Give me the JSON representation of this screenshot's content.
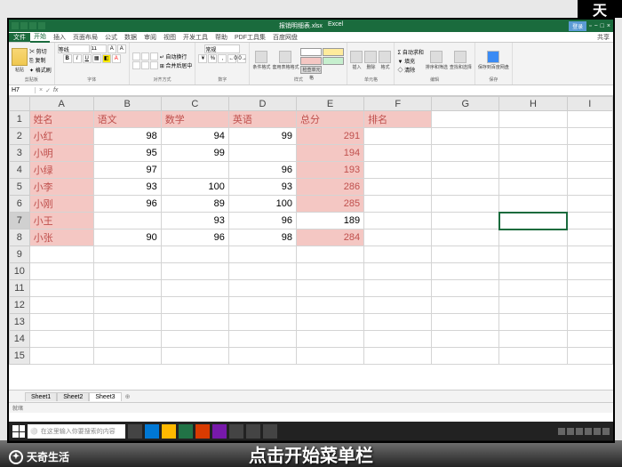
{
  "app": {
    "doc_title": "报销明细表.xlsx",
    "app_name": "Excel",
    "signin": "登录"
  },
  "tabs": {
    "file": "文件",
    "items": [
      "开始",
      "插入",
      "页面布局",
      "公式",
      "数据",
      "审阅",
      "视图",
      "开发工具",
      "帮助",
      "PDF工具集",
      "百度网盘"
    ],
    "active": 0,
    "share": "共享"
  },
  "ribbon": {
    "clipboard": {
      "paste": "粘贴",
      "cut": "剪切",
      "copy": "复制",
      "label": "剪贴板"
    },
    "font": {
      "name": "等线",
      "size": "11",
      "label": "字体"
    },
    "align": {
      "wrap": "自动换行",
      "merge": "合并后居中",
      "label": "对齐方式"
    },
    "number": {
      "format": "常规",
      "label": "数字"
    },
    "styles": {
      "cond": "条件格式",
      "table": "套用表格格式",
      "cell": "检查单元格",
      "label": "样式"
    },
    "cells": {
      "insert": "插入",
      "delete": "删除",
      "format": "格式",
      "label": "单元格"
    },
    "editing": {
      "sum": "自动求和",
      "fill": "填充",
      "clear": "清除",
      "sort": "排序和筛选",
      "find": "查找和选择",
      "label": "编辑"
    },
    "addin": {
      "save": "保存到百度网盘",
      "label": "保存"
    }
  },
  "namebox": "H7",
  "cols": [
    "A",
    "B",
    "C",
    "D",
    "E",
    "F",
    "G",
    "H",
    "I"
  ],
  "headers": {
    "A": "姓名",
    "B": "语文",
    "C": "数学",
    "D": "英语",
    "E": "总分",
    "F": "排名"
  },
  "chart_data": {
    "type": "table",
    "columns": [
      "姓名",
      "语文",
      "数学",
      "英语",
      "总分",
      "排名"
    ],
    "rows": [
      {
        "name": "小红",
        "chinese": 98,
        "math": 94,
        "english": 99,
        "total": 291,
        "rank": null
      },
      {
        "name": "小明",
        "chinese": 95,
        "math": 99,
        "english": null,
        "total": 194,
        "rank": null
      },
      {
        "name": "小绿",
        "chinese": 97,
        "math": null,
        "english": 96,
        "total": 193,
        "rank": null
      },
      {
        "name": "小李",
        "chinese": 93,
        "math": 100,
        "english": 93,
        "total": 286,
        "rank": null
      },
      {
        "name": "小刚",
        "chinese": 96,
        "math": 89,
        "english": 100,
        "total": 285,
        "rank": null
      },
      {
        "name": "小王",
        "chinese": null,
        "math": 93,
        "english": 96,
        "total": 189,
        "rank": null
      },
      {
        "name": "小张",
        "chinese": 90,
        "math": 96,
        "english": 98,
        "total": 284,
        "rank": null
      }
    ]
  },
  "active_cell": "H7",
  "sheet_tabs": [
    "Sheet1",
    "Sheet2",
    "Sheet3"
  ],
  "active_sheet": 2,
  "status": "就绪",
  "taskbar": {
    "search_placeholder": "在这里输入你要搜索的内容"
  },
  "subtitle": "点击开始菜单栏",
  "watermark_top": "天",
  "watermark_bl": "天奇生活"
}
